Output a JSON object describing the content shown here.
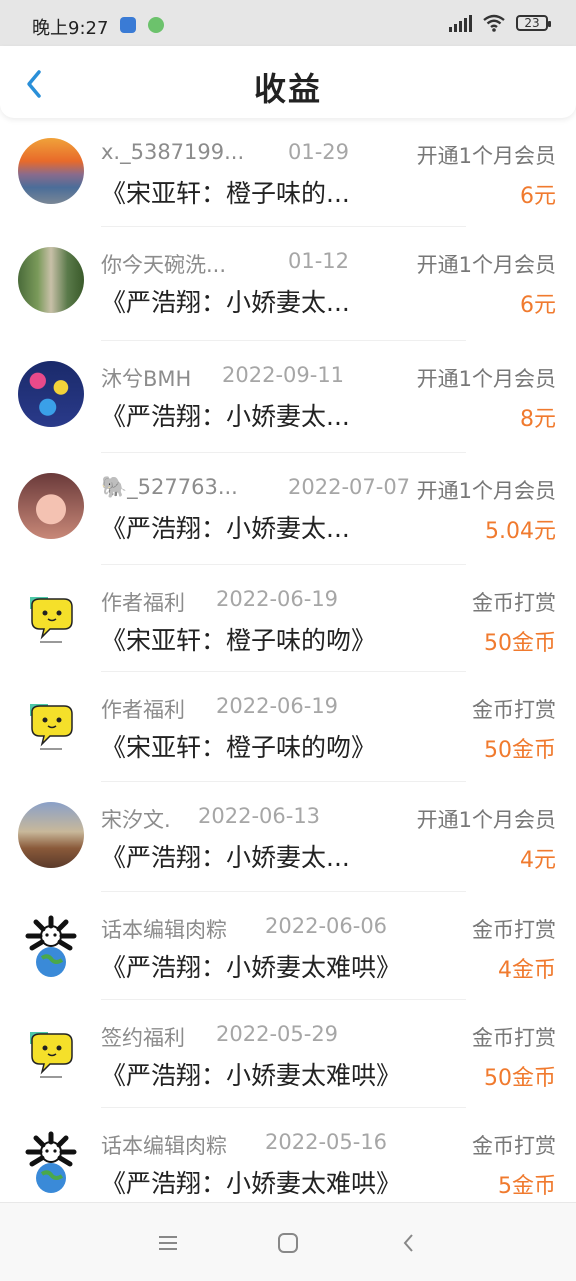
{
  "status_bar": {
    "time": "晚上9:27",
    "battery": "23"
  },
  "header": {
    "title": "收益"
  },
  "items": [
    {
      "user": "x._5387199...",
      "date": "01-29",
      "type": "开通1个月会员",
      "book": "《宋亚轩：橙子味的...",
      "amount": "6元"
    },
    {
      "user": "你今天碗洗...",
      "date": "01-12",
      "type": "开通1个月会员",
      "book": "《严浩翔：小娇妻太...",
      "amount": "6元"
    },
    {
      "user": "沐兮BMH",
      "date": "2022-09-11",
      "type": "开通1个月会员",
      "book": "《严浩翔：小娇妻太...",
      "amount": "8元"
    },
    {
      "user": "🐘_527763...",
      "date": "2022-07-07",
      "type": "开通1个月会员",
      "book": "《严浩翔：小娇妻太...",
      "amount": "5.04元"
    },
    {
      "user": "作者福利",
      "date": "2022-06-19",
      "type": "金币打赏",
      "book": "《宋亚轩：橙子味的吻》",
      "amount": "50金币"
    },
    {
      "user": "作者福利",
      "date": "2022-06-19",
      "type": "金币打赏",
      "book": "《宋亚轩：橙子味的吻》",
      "amount": "50金币"
    },
    {
      "user": "宋汐文.",
      "date": "2022-06-13",
      "type": "开通1个月会员",
      "book": "《严浩翔：小娇妻太...",
      "amount": "4元"
    },
    {
      "user": "话本编辑肉粽",
      "date": "2022-06-06",
      "type": "金币打赏",
      "book": "《严浩翔：小娇妻太难哄》",
      "amount": "4金币"
    },
    {
      "user": "签约福利",
      "date": "2022-05-29",
      "type": "金币打赏",
      "book": "《严浩翔：小娇妻太难哄》",
      "amount": "50金币"
    },
    {
      "user": "话本编辑肉粽",
      "date": "2022-05-16",
      "type": "金币打赏",
      "book": "《严浩翔：小娇妻太难哄》",
      "amount": "5金币"
    }
  ],
  "colors": {
    "amount": "#f07a2e",
    "back_arrow": "#2a8fd8"
  }
}
